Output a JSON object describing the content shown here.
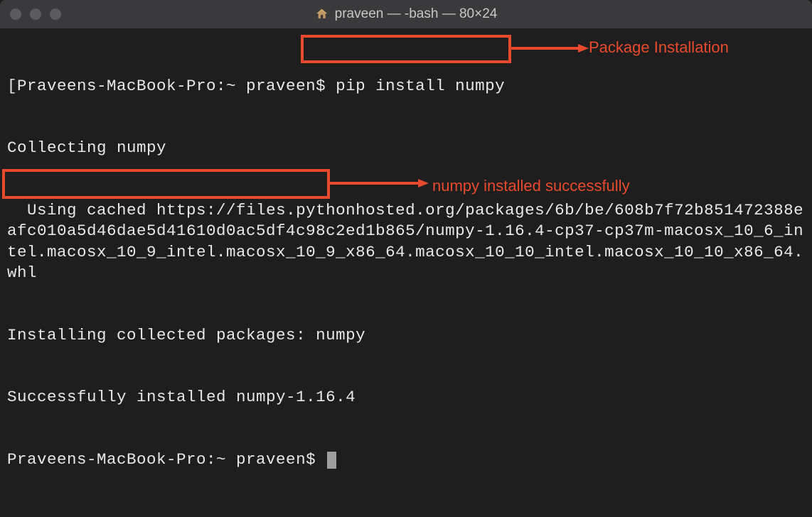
{
  "titlebar": {
    "title": "praveen — -bash — 80×24",
    "window_controls": [
      "close",
      "minimize",
      "maximize"
    ]
  },
  "terminal": {
    "line1_prompt": "[Praveens-MacBook-Pro:~ praveen$ ",
    "line1_command": "pip install numpy",
    "line2": "Collecting numpy",
    "line3": "  Using cached https://files.pythonhosted.org/packages/6b/be/608b7f72b851472388eafc010a5d46dae5d41610d0ac5df4c98c2ed1b865/numpy-1.16.4-cp37-cp37m-macosx_10_6_intel.macosx_10_9_intel.macosx_10_9_x86_64.macosx_10_10_intel.macosx_10_10_x86_64.whl",
    "line4": "Installing collected packages: numpy",
    "line5": "Successfully installed numpy-1.16.4",
    "line6_prompt": "Praveens-MacBook-Pro:~ praveen$ "
  },
  "annotations": {
    "label1": "Package Installation",
    "label2": "numpy installed successfully"
  },
  "colors": {
    "annotation": "#e84a2d",
    "terminal_bg": "#1e1e1e",
    "terminal_fg": "#e8e8e8",
    "titlebar_bg": "#3a3a3c"
  }
}
